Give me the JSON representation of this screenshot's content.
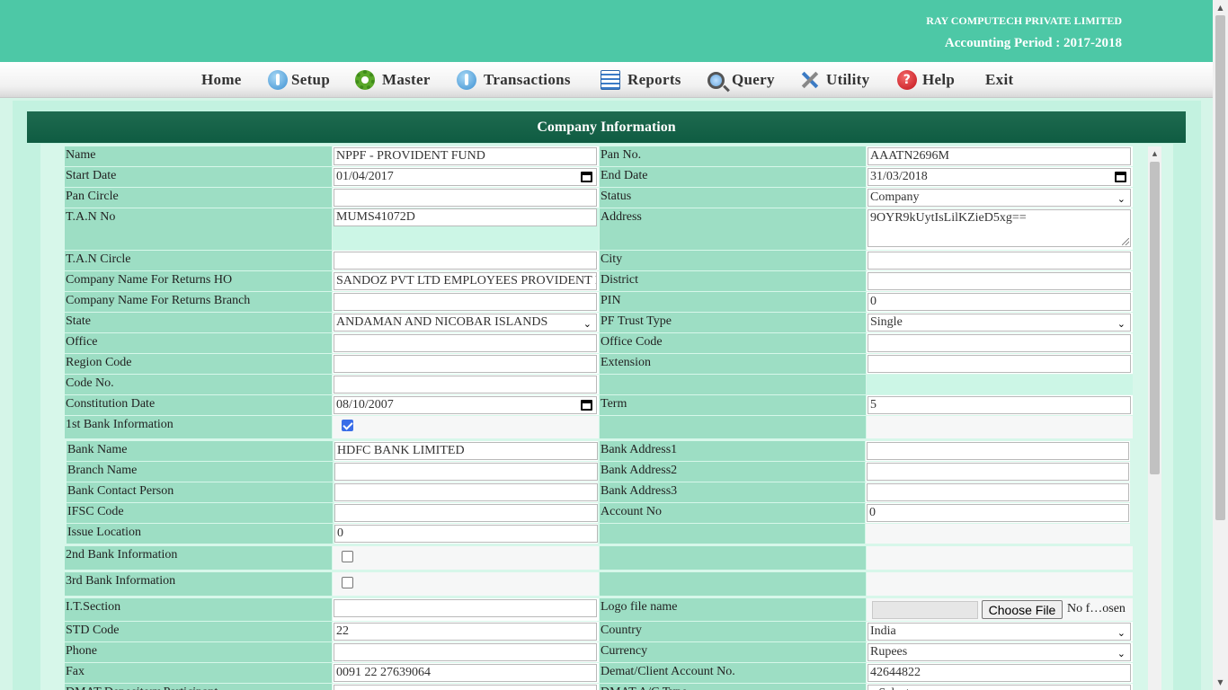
{
  "header": {
    "company_name": "RAY COMPUTECH PRIVATE LIMITED",
    "period": "Accounting Period : 2017-2018"
  },
  "menu": {
    "home": "Home",
    "setup": "Setup",
    "master": "Master",
    "transactions": "Transactions",
    "reports": "Reports",
    "query": "Query",
    "utility": "Utility",
    "help": "Help",
    "exit": "Exit"
  },
  "panel": {
    "title": "Company Information"
  },
  "labels": {
    "name": "Name",
    "pan_no": "Pan No.",
    "start_date": "Start Date",
    "end_date": "End Date",
    "pan_circle": "Pan Circle",
    "status": "Status",
    "tan_no": "T.A.N No",
    "address": "Address",
    "tan_circle": "T.A.N Circle",
    "city": "City",
    "name_ho": "Company Name For Returns HO",
    "district": "District",
    "name_branch": "Company Name For Returns Branch",
    "pin": "PIN",
    "state": "State",
    "pf_trust_type": "PF Trust Type",
    "office": "Office",
    "office_code": "Office Code",
    "region_code": "Region Code",
    "extension": "Extension",
    "code_no": "Code No.",
    "constitution_date": "Constitution Date",
    "term": "Term",
    "bank1_info": "1st Bank Information",
    "bank_name": "Bank Name",
    "bank_address1": "Bank Address1",
    "branch_name": "Branch Name",
    "bank_address2": "Bank Address2",
    "bank_contact": "Bank Contact Person",
    "bank_address3": "Bank Address3",
    "ifsc": "IFSC Code",
    "account_no": "Account No",
    "issue_location": "Issue Location",
    "bank2_info": "2nd Bank Information",
    "bank3_info": "3rd Bank Information",
    "it_section": "I.T.Section",
    "logo_file": "Logo file name",
    "std_code": "STD Code",
    "country": "Country",
    "phone": "Phone",
    "currency": "Currency",
    "fax": "Fax",
    "demat_account": "Demat/Client Account No.",
    "dmat_dp": "DMAT Depository Participant",
    "dmat_ac_type": "DMAT A/C Type"
  },
  "values": {
    "name": "NPPF - PROVIDENT FUND",
    "pan_no": "AAATN2696M",
    "start_date": "01/04/2017",
    "end_date": "31/03/2018",
    "pan_circle": "",
    "status": "Company",
    "tan_no": "MUMS41072D",
    "address": "9OYR9kUytIsLilKZieD5xg==",
    "tan_circle": "",
    "city": "",
    "name_ho": "SANDOZ PVT LTD EMPLOYEES PROVIDENT FUND",
    "district": "",
    "name_branch": "",
    "pin": "0",
    "state": "ANDAMAN AND NICOBAR ISLANDS",
    "pf_trust_type": "Single",
    "office": "",
    "office_code": "",
    "region_code": "",
    "extension": "",
    "code_no": "",
    "constitution_date": "08/10/2007",
    "term": "5",
    "bank_name": "HDFC BANK LIMITED",
    "bank_address1": "",
    "branch_name": "",
    "bank_address2": "",
    "bank_contact": "",
    "bank_address3": "",
    "ifsc": "",
    "account_no": "0",
    "issue_location": "0",
    "it_section": "",
    "logo_button": "Choose File",
    "logo_status": "No f…osen",
    "std_code": "22",
    "country": "India",
    "phone": "",
    "currency": "Rupees",
    "fax": "0091 22 27639064",
    "demat_account": "42644822",
    "dmat_dp": "",
    "dmat_ac_type": "--Select--"
  }
}
